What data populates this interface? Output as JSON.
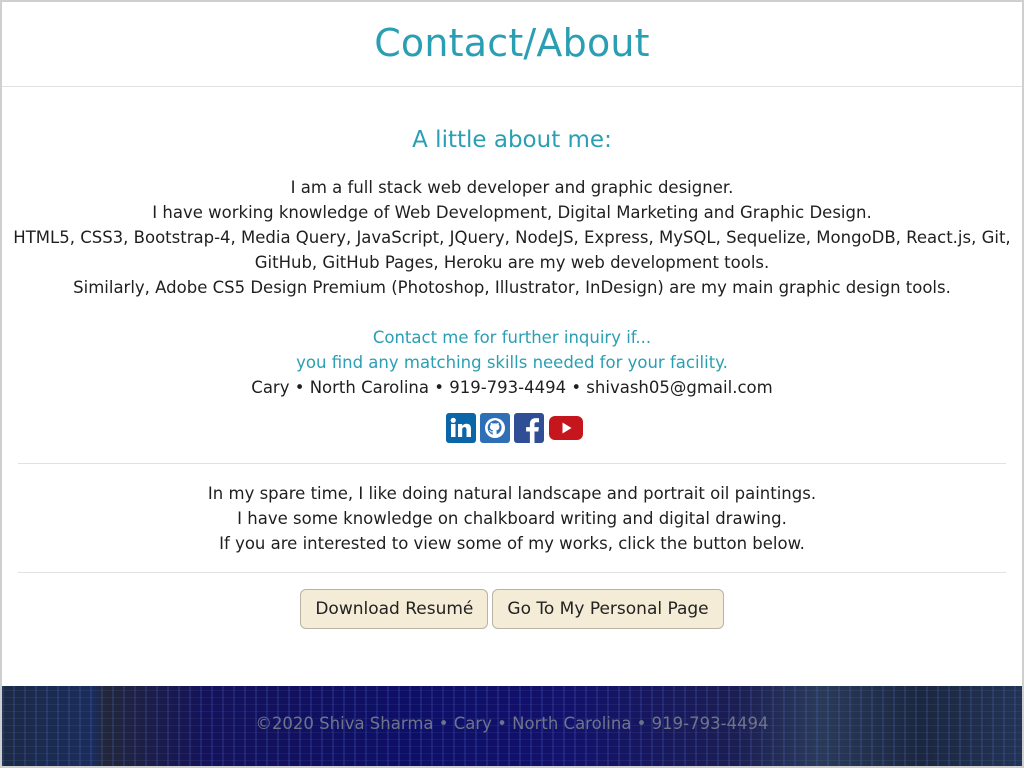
{
  "header": {
    "title": "Contact/About"
  },
  "about": {
    "heading": "A little about me:",
    "lines": [
      "I am a full stack web developer and graphic designer.",
      "I have working knowledge of Web Development, Digital Marketing and Graphic Design.",
      "HTML5, CSS3, Bootstrap-4, Media Query, JavaScript, JQuery, NodeJS, Express, MySQL, Sequelize, MongoDB, React.js, Git,",
      "GitHub, GitHub Pages, Heroku are my web development tools.",
      "Similarly, Adobe CS5 Design Premium (Photoshop, Illustrator, InDesign) are my main graphic design tools."
    ]
  },
  "contact": {
    "line1": "Contact me for further inquiry if...",
    "line2": "you find any matching skills needed for your facility.",
    "details": "Cary • North Carolina • 919-793-4494 • shivash05@gmail.com"
  },
  "socials": [
    {
      "name": "linkedin-icon",
      "color": "#0a66a8"
    },
    {
      "name": "github-icon",
      "color": "#2f6fb6"
    },
    {
      "name": "facebook-icon",
      "color": "#2f4e96"
    },
    {
      "name": "youtube-icon",
      "color": "#c4161c"
    }
  ],
  "spare": {
    "lines": [
      "In my spare time, I like doing natural landscape and portrait oil paintings.",
      "I have some knowledge on chalkboard writing and digital drawing.",
      "If you are interested to view some of my works, click the button below."
    ]
  },
  "buttons": {
    "resume": "Download Resumé",
    "personal": "Go To My Personal Page"
  },
  "footer": {
    "text": "©2020 Shiva Sharma • Cary • North Carolina • 919-793-4494"
  }
}
